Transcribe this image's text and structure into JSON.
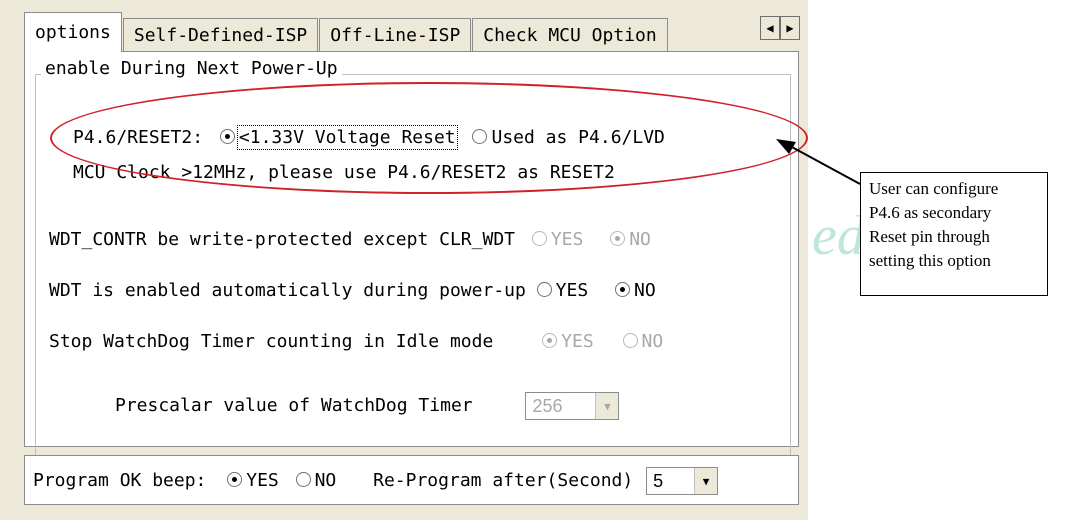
{
  "tabs": [
    {
      "label": "options"
    },
    {
      "label": "Self-Defined-ISP"
    },
    {
      "label": "Off-Line-ISP"
    },
    {
      "label": "Check MCU Option"
    }
  ],
  "tab_scroll": {
    "left": "◀",
    "right": "▶"
  },
  "group_title": "enable During Next Power-Up",
  "reset2": {
    "label": "P4.6/RESET2:",
    "option1": "<1.33V Voltage Reset",
    "option2": "Used as P4.6/LVD",
    "selected": "option1"
  },
  "clock_note": "MCU Clock >12MHz, please use P4.6/RESET2 as RESET2",
  "wdt_protect": {
    "label": "WDT_CONTR be write-protected except CLR_WDT",
    "yes": "YES",
    "no": "NO",
    "selected": "NO",
    "enabled": false
  },
  "wdt_auto": {
    "label": "WDT is enabled automatically during power-up",
    "yes": "YES",
    "no": "NO",
    "selected": "NO",
    "enabled": true
  },
  "wdt_idle": {
    "label": "Stop WatchDog Timer counting in Idle mode",
    "yes": "YES",
    "no": "NO",
    "selected": "YES",
    "enabled": false
  },
  "prescalar": {
    "label": "Prescalar value of WatchDog Timer",
    "value": "256",
    "enabled": false
  },
  "beep": {
    "label": "Program OK beep:",
    "yes": "YES",
    "no": "NO",
    "selected": "YES"
  },
  "reprogram": {
    "label": "Re-Program after(Second)",
    "value": "5"
  },
  "callout_lines": [
    "User can configure",
    "P4.6 as secondary",
    "Reset pin through",
    "setting this option"
  ],
  "watermark": "ed",
  "colors": {
    "highlight": "#d0202a",
    "disabled_text": "#a8a8a8",
    "window_bg": "#ece9d8"
  }
}
